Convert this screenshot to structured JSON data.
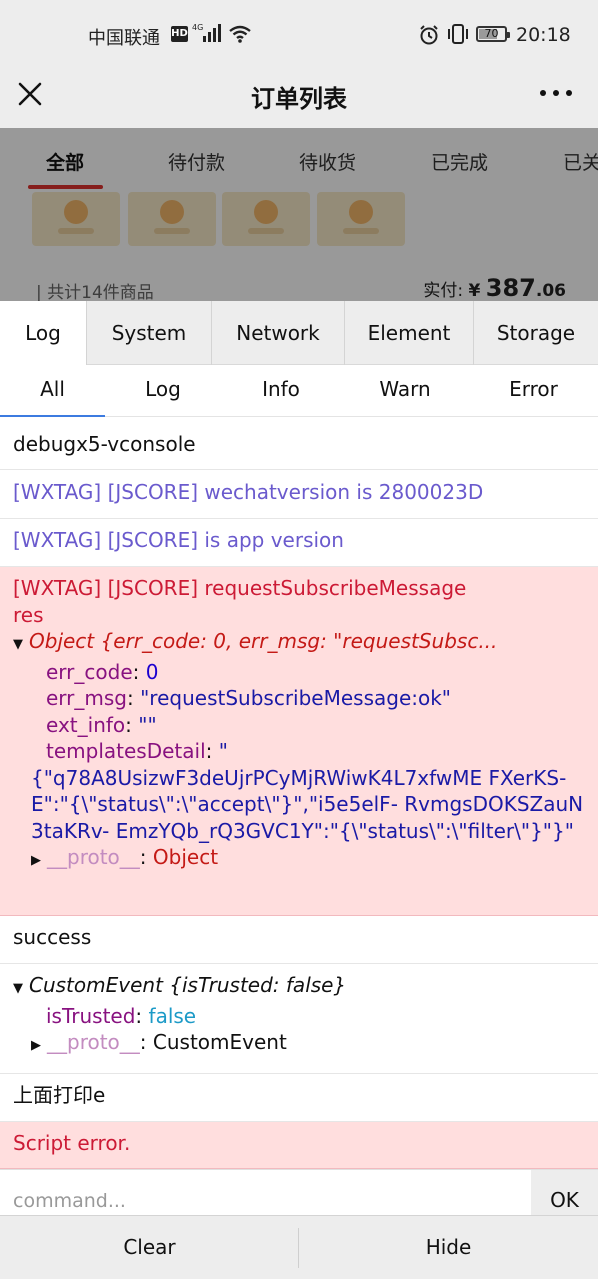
{
  "status_bar": {
    "carrier": "中国联通",
    "hd_badge": "HD",
    "network": "4G",
    "battery": "70",
    "battery_level": 0.7,
    "time": "20:18"
  },
  "nav": {
    "title": "订单列表"
  },
  "order_page": {
    "tabs": [
      "全部",
      "待付款",
      "待收货",
      "已完成",
      "已关"
    ],
    "active_tab": 0,
    "total_items": "| 共计14件商品",
    "paid_label": "实付:",
    "currency": "¥",
    "amount_int": "387",
    "amount_dec": ".06",
    "accent_color": "#e0322f"
  },
  "vconsole": {
    "tabs": [
      "Log",
      "System",
      "Network",
      "Element",
      "Storage"
    ],
    "active_tab": 0,
    "sub_tabs": [
      "All",
      "Log",
      "Info",
      "Warn",
      "Error"
    ],
    "active_sub_tab": 0,
    "logs": {
      "l1": "debugx5-vconsole",
      "l2": "[WXTAG] [JSCORE] wechatversion is 2800023D",
      "l3": "[WXTAG] [JSCORE] is app version",
      "l4_line1": "[WXTAG] [JSCORE] requestSubscribeMessage",
      "l4_line2": "res",
      "l4_obj_head": "Object {err_code: 0, err_msg: \"requestSubsc...",
      "l4_err_code_key": "err_code",
      "l4_err_code_val": "0",
      "l4_err_msg_key": "err_msg",
      "l4_err_msg_val": "\"requestSubscribeMessage:ok\"",
      "l4_ext_info_key": "ext_info",
      "l4_ext_info_val": "\"\"",
      "l4_templates_key": "templatesDetail",
      "l4_templates_open": "\"",
      "l4_templates_val": "{\"q78A8UsizwF3deUjrPCyMjRWiwK4L7xfwME FXerKS-E\":\"{\\\"status\\\":\\\"accept\\\"}\",\"i5e5elF- RvmgsDOKSZauN3taKRv- EmzYQb_rQ3GVC1Y\":\"{\\\"status\\\":\\\"filter\\\"}\"}\"",
      "l4_proto_key": "__proto__",
      "l4_proto_val": "Object",
      "l5": "success",
      "l6_obj_head": "CustomEvent {isTrusted: false}",
      "l6_trusted_key": "isTrusted",
      "l6_trusted_val": "false",
      "l6_proto_key": "__proto__",
      "l6_proto_val": "CustomEvent",
      "l7": "上面打印e",
      "l8": "Script error."
    },
    "command_placeholder": "command...",
    "ok_label": "OK",
    "clear_label": "Clear",
    "hide_label": "Hide"
  }
}
